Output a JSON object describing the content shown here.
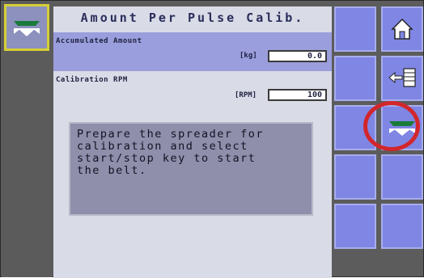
{
  "title": "Amount Per Pulse Calib.",
  "accumulated": {
    "label": "Accumulated Amount",
    "unit": "[kg]",
    "value": "0.0"
  },
  "rpm": {
    "label": "Calibration RPM",
    "unit": "[RPM]",
    "value": "100"
  },
  "message": "Prepare the spreader for\ncalibration and select\nstart/stop key to start\nthe belt.",
  "soft_keys": [
    "home-icon",
    "menu-back-icon",
    "spreader-start-stop-icon"
  ],
  "colors": {
    "key_bg": "#7f86e3",
    "accent_highlight": "#d2262b",
    "panel": "#d9dbe7",
    "field_band": "#9a9edc"
  }
}
